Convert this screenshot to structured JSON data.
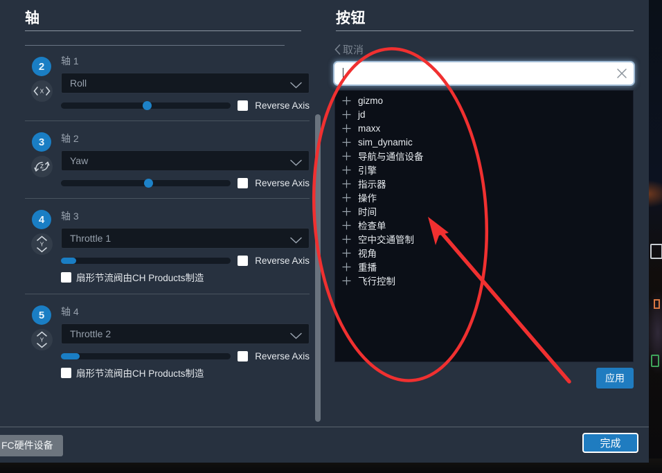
{
  "left_panel": {
    "title": "轴",
    "axes": [
      {
        "badge": "2",
        "icon": "axis-x-icon",
        "name": "轴 1",
        "binding": "Roll",
        "slider_fill_pct": 0,
        "slider_knob_pct": 48,
        "reverse_label": "Reverse Axis",
        "extra_label": null
      },
      {
        "badge": "3",
        "icon": "axis-z-rotate-icon",
        "name": "轴 2",
        "binding": "Yaw",
        "slider_fill_pct": 0,
        "slider_knob_pct": 49,
        "reverse_label": "Reverse Axis",
        "extra_label": null
      },
      {
        "badge": "4",
        "icon": "axis-y-icon",
        "name": "轴 3",
        "binding": "Throttle 1",
        "slider_fill_pct": 9,
        "slider_knob_pct": -1,
        "reverse_label": "Reverse Axis",
        "extra_label": "扇形节流阀由CH Products制造"
      },
      {
        "badge": "5",
        "icon": "axis-y-icon",
        "name": "轴 4",
        "binding": "Throttle 2",
        "slider_fill_pct": 11,
        "slider_knob_pct": -1,
        "reverse_label": "Reverse Axis",
        "extra_label": "扇形节流阀由CH Products制造"
      }
    ]
  },
  "right_panel": {
    "title": "按钮",
    "back_label": "取消",
    "search": {
      "value": "",
      "placeholder": "",
      "clear_icon": "close-icon"
    },
    "list_items": [
      "gizmo",
      "jd",
      "maxx",
      "sim_dynamic",
      "导航与通信设备",
      "引擎",
      "指示器",
      "操作",
      "时间",
      "检查单",
      "空中交通管制",
      "视角",
      "重播",
      "飞行控制"
    ],
    "apply_label": "应用"
  },
  "footer": {
    "hardware_label": "FC硬件设备",
    "done_label": "完成"
  },
  "colors": {
    "accent": "#1a7ec4",
    "panel_bg": "#27313f",
    "list_bg": "#0b0f17",
    "annotation_red": "#f03030",
    "text_primary": "#e6eaee",
    "text_muted": "#98a2ae"
  }
}
